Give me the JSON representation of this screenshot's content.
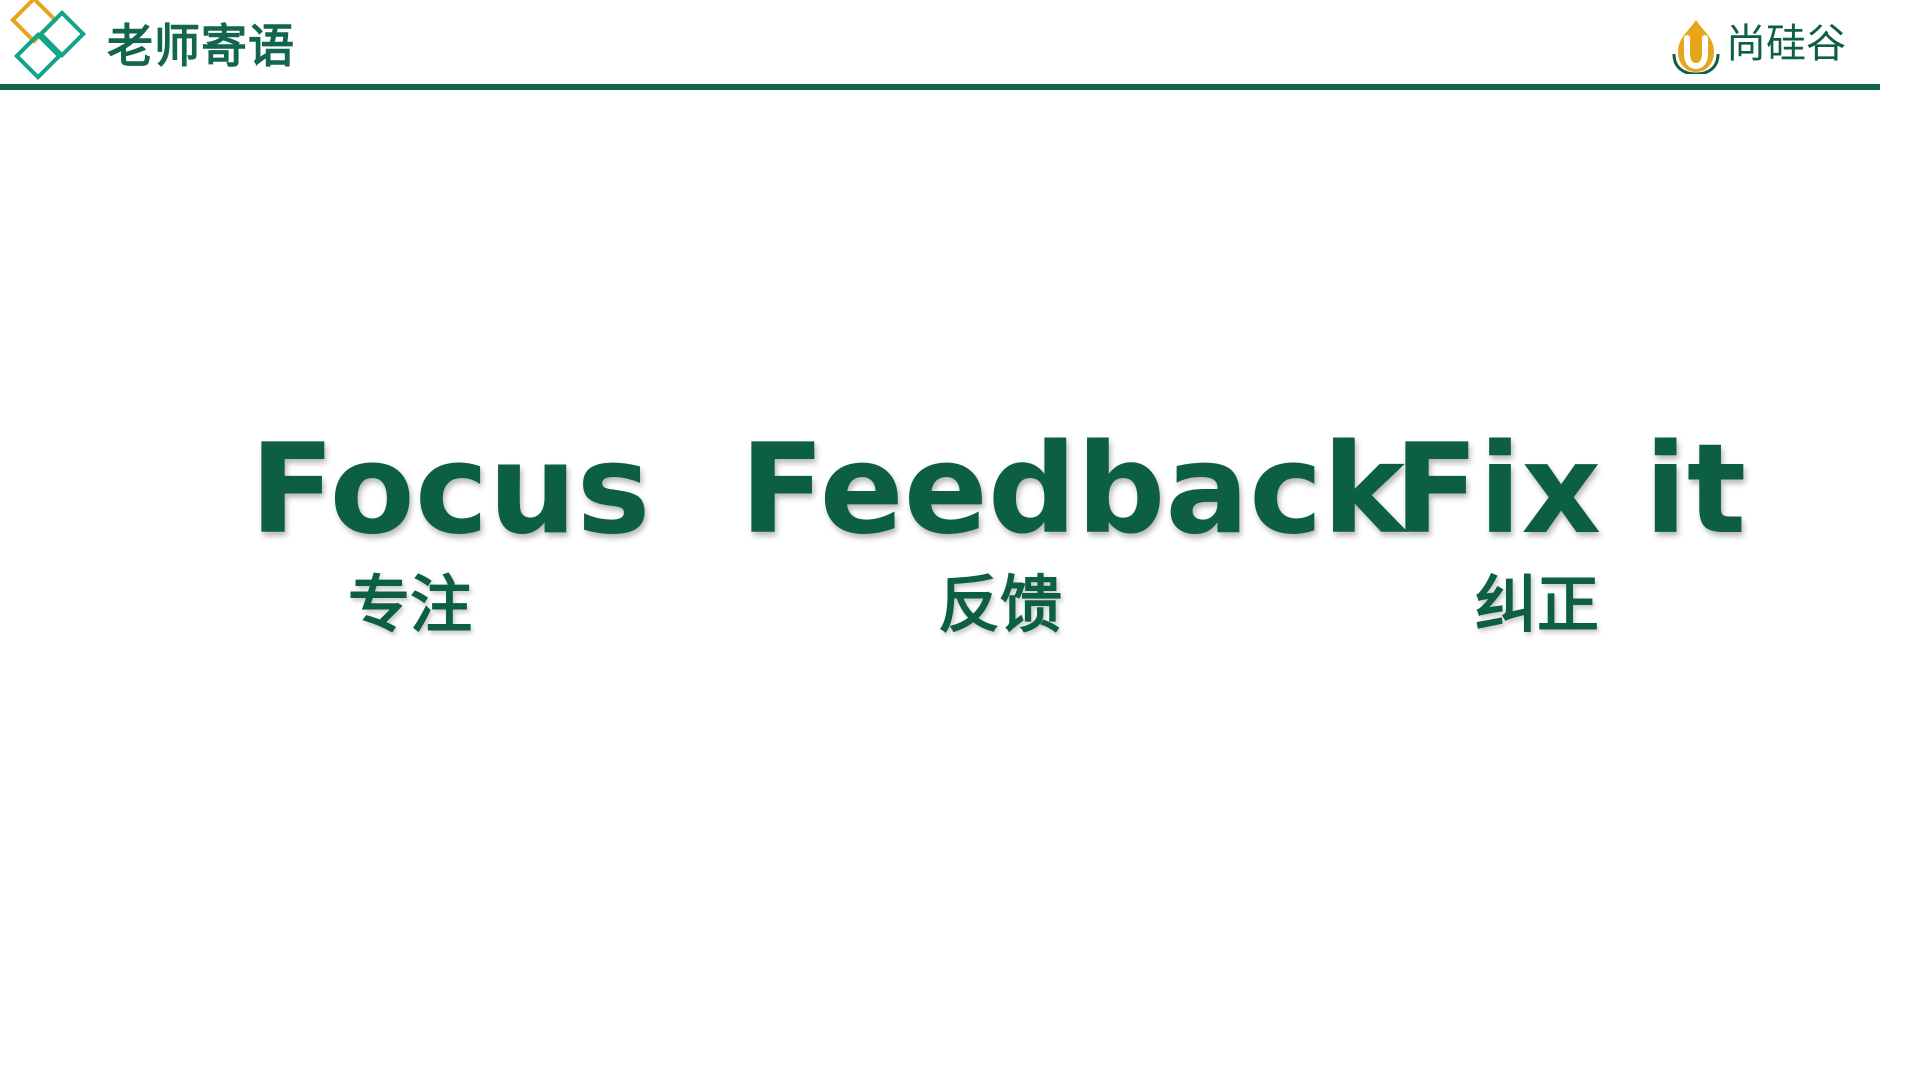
{
  "header": {
    "title": "老师寄语",
    "logo_icon": "diamond-cluster-icon",
    "accent_color": "#13664e",
    "logo_colors": [
      "#e7a51d",
      "#13a58a",
      "#13664e"
    ]
  },
  "brand": {
    "name": "尚硅谷",
    "icon": "u-flame-icon",
    "color": "#0d5f44",
    "icon_color": "#e7a51d"
  },
  "keywords": [
    {
      "en": "Focus",
      "zh": "专注"
    },
    {
      "en": "Feedback",
      "zh": "反馈"
    },
    {
      "en": "Fix it",
      "zh": "纠正"
    }
  ],
  "text_color": "#0d5f44"
}
